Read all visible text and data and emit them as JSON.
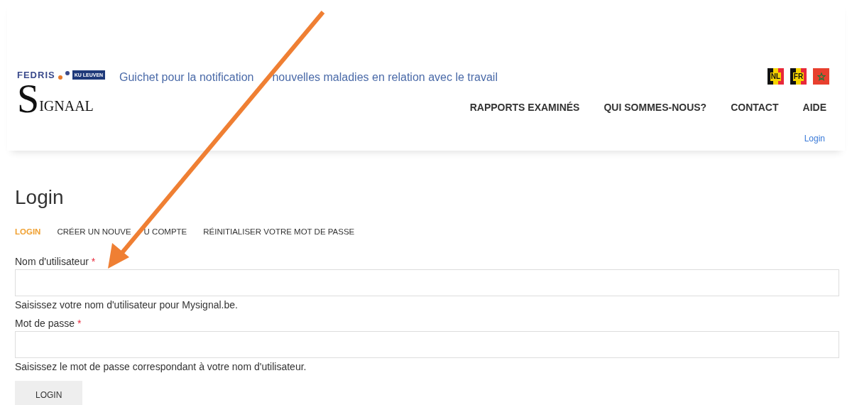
{
  "header": {
    "logo": {
      "top": "FEDRIS",
      "badge": "KU LEUVEN",
      "big": "S",
      "rest": "IGNAAL"
    },
    "tagline_parts": [
      "Guichet pour la notification",
      "nouvelles maladies en relation avec le travail"
    ],
    "languages": [
      {
        "label": "NL",
        "kind": "belgium"
      },
      {
        "label": "FR",
        "kind": "belgium"
      },
      {
        "kind": "morocco"
      }
    ],
    "nav": [
      "RAPPORTS EXAMINÉS",
      "QUI SOMMES-NOUS?",
      "CONTACT",
      "AIDE"
    ],
    "login_link": "Login"
  },
  "page": {
    "title": "Login",
    "tabs": [
      {
        "label_parts": [
          "LOGIN"
        ],
        "selected": true
      },
      {
        "label_parts": [
          "CRÉER UN NOUVE",
          "U COMPTE"
        ],
        "selected": false
      },
      {
        "label_parts": [
          "RÉINITIALISER VOTRE MOT DE PASSE"
        ],
        "selected": false
      }
    ],
    "fields": [
      {
        "label": "Nom d'utilisateur",
        "required_mark": "*",
        "help": "Saisissez votre nom d'utilisateur pour Mysignal.be."
      },
      {
        "label": "Mot de passe",
        "required_mark": "*",
        "help": "Saisissez le mot de passe correspondant à votre nom d'utilisateur."
      }
    ],
    "submit": "LOGIN"
  },
  "annotation": {
    "kind": "arrow",
    "color": "#ef7f33"
  }
}
